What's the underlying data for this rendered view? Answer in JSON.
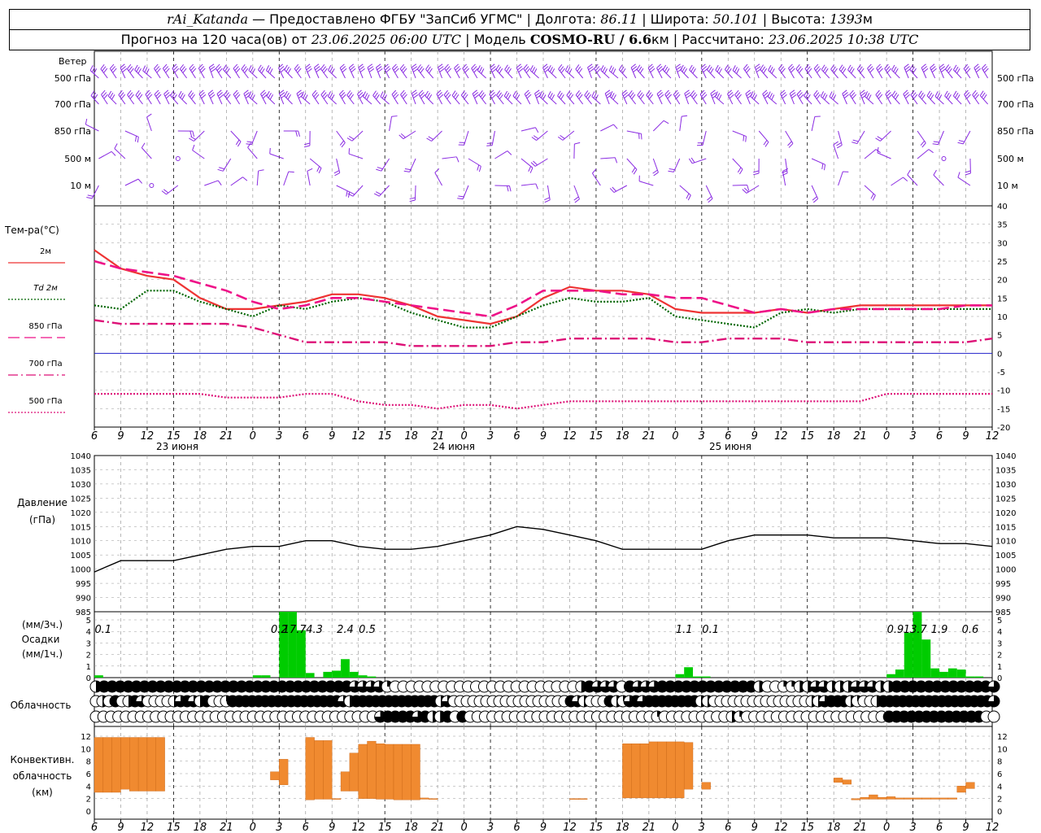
{
  "header": {
    "station": "rAi_Katanda",
    "dash": "—",
    "provided": "Предоставлено ФГБУ \"ЗапСиб УГМС\"",
    "lon_label": "Долгота:",
    "lon": "86.11",
    "lat_label": "Широта:",
    "lat": "50.101",
    "alt_label": "Высота:",
    "alt": "1393",
    "alt_unit": "м",
    "forecast_prefix": "Прогноз на 120 часа(ов) от",
    "forecast_date": "23.06.2025 06:00 UTC",
    "model_label": "Модель",
    "model": "COSMO-RU / 6.6",
    "model_unit": "км",
    "calc_label": "Рассчитано:",
    "calc_date": "23.06.2025 10:38 UTC"
  },
  "colors": {
    "wind": "#8a2be2",
    "t2m": "#ee3333",
    "td2m": "#006600",
    "t850": "#ee1188",
    "t700": "#dd1177",
    "t500": "#dd1177",
    "zero_line": "#2222cc",
    "pressure": "#000000",
    "precip": "#00cc00",
    "conv": "#f08a30",
    "grid": "#999999"
  },
  "chart_data": [
    {
      "type": "wind_barbs",
      "panel_label": "Ветер",
      "levels": [
        "500 гПа",
        "700 гПа",
        "850 гПа",
        "500 м",
        "10 м"
      ]
    },
    {
      "type": "line",
      "panel_label": "Тем-ра(°C)",
      "ylim": [
        -20,
        40
      ],
      "yticks": [
        -20,
        -15,
        -10,
        -5,
        0,
        5,
        10,
        15,
        20,
        25,
        30,
        35,
        40
      ],
      "x_hours": [
        0,
        3,
        6,
        9,
        12,
        15,
        18,
        21,
        24,
        27,
        30,
        33,
        36,
        39,
        42,
        45,
        48,
        51,
        54,
        57,
        60,
        63,
        66,
        69,
        72,
        75,
        78,
        81,
        84,
        87,
        90,
        93,
        96,
        99,
        102
      ],
      "x_tick_labels": [
        "6",
        "9",
        "12",
        "15",
        "18",
        "21",
        "0",
        "3",
        "6",
        "9",
        "12",
        "15",
        "18",
        "21",
        "0",
        "3",
        "6",
        "9",
        "12",
        "15",
        "18",
        "21",
        "0",
        "3",
        "6",
        "9",
        "12",
        "15",
        "18",
        "21",
        "0",
        "3",
        "6",
        "9",
        "12"
      ],
      "day_labels": [
        "23 июня",
        "24 июня",
        "25 июня"
      ],
      "series": [
        {
          "name": "2м",
          "style": "solid",
          "values": [
            28,
            23,
            21,
            20,
            15,
            12,
            12,
            13,
            14,
            16,
            16,
            15,
            13,
            10,
            9,
            8,
            10,
            15,
            18,
            17,
            17,
            16,
            12,
            11,
            11,
            11,
            12,
            11,
            12,
            13,
            13,
            13,
            13,
            13,
            13
          ]
        },
        {
          "name": "Td 2м",
          "style": "dotted",
          "values": [
            13,
            12,
            17,
            17,
            14,
            12,
            10,
            13,
            12,
            14,
            15,
            14,
            11,
            9,
            7,
            7,
            10,
            13,
            15,
            14,
            14,
            15,
            10,
            9,
            8,
            7,
            11,
            12,
            11,
            12,
            12,
            12,
            12,
            12,
            12
          ]
        },
        {
          "name": "850 гПа",
          "style": "longdash",
          "values": [
            25,
            23,
            22,
            21,
            19,
            17,
            14,
            12,
            13,
            15,
            15,
            14,
            13,
            12,
            11,
            10,
            13,
            17,
            17,
            17,
            16,
            16,
            15,
            15,
            13,
            11,
            12,
            11,
            12,
            12,
            12,
            12,
            12,
            13,
            13
          ]
        },
        {
          "name": "700 гПа",
          "style": "dashdot",
          "values": [
            9,
            8,
            8,
            8,
            8,
            8,
            7,
            5,
            3,
            3,
            3,
            3,
            2,
            2,
            2,
            2,
            3,
            3,
            4,
            4,
            4,
            4,
            3,
            3,
            4,
            4,
            4,
            3,
            3,
            3,
            3,
            3,
            3,
            3,
            4
          ]
        },
        {
          "name": "500 гПа",
          "style": "dotted",
          "values": [
            -11,
            -11,
            -11,
            -11,
            -11,
            -12,
            -12,
            -12,
            -11,
            -11,
            -13,
            -14,
            -14,
            -15,
            -14,
            -14,
            -15,
            -14,
            -13,
            -13,
            -13,
            -13,
            -13,
            -13,
            -13,
            -13,
            -13,
            -13,
            -13,
            -13,
            -11,
            -11,
            -11,
            -11,
            -11
          ]
        }
      ]
    },
    {
      "type": "line",
      "panel_label": "Давление",
      "panel_unit": "(гПа)",
      "ylim": [
        985,
        1040
      ],
      "yticks": [
        985,
        990,
        995,
        1000,
        1005,
        1010,
        1015,
        1020,
        1025,
        1030,
        1035,
        1040
      ],
      "series": [
        {
          "name": "Давление",
          "values": [
            999,
            1003,
            1003,
            1003,
            1005,
            1007,
            1008,
            1008,
            1010,
            1010,
            1008,
            1007,
            1007,
            1008,
            1010,
            1012,
            1015,
            1014,
            1012,
            1010,
            1007,
            1007,
            1007,
            1007,
            1010,
            1012,
            1012,
            1012,
            1011,
            1011,
            1011,
            1010,
            1009,
            1009,
            1008
          ]
        }
      ]
    },
    {
      "type": "bar",
      "panel_label_top": "(мм/3ч.)",
      "panel_label_mid": "Осадки",
      "panel_label_bot": "(мм/1ч.)",
      "ylim": [
        0,
        5
      ],
      "yticks": [
        0,
        1,
        2,
        3,
        4,
        5
      ],
      "labels_3h": [
        {
          "hour": 2,
          "text": "0.1"
        },
        {
          "hour": 42,
          "text": "0.2"
        },
        {
          "hour": 45.5,
          "text": "17.7"
        },
        {
          "hour": 50,
          "text": "4.3"
        },
        {
          "hour": 57,
          "text": "2.4"
        },
        {
          "hour": 62,
          "text": "0.5"
        },
        {
          "hour": 134,
          "text": "1.1"
        },
        {
          "hour": 140,
          "text": "0.1"
        },
        {
          "hour": 182,
          "text": "0.9"
        },
        {
          "hour": 186.5,
          "text": "13.7"
        },
        {
          "hour": 192,
          "text": "1.9"
        },
        {
          "hour": 199,
          "text": "0.6"
        }
      ],
      "bars": [
        {
          "hour": 0,
          "value": 0.2
        },
        {
          "hour": 36,
          "value": 0.2
        },
        {
          "hour": 38,
          "value": 0.2
        },
        {
          "hour": 42,
          "value": 5.8
        },
        {
          "hour": 44,
          "value": 5.8
        },
        {
          "hour": 46,
          "value": 4.1
        },
        {
          "hour": 48,
          "value": 0.4
        },
        {
          "hour": 52,
          "value": 0.5
        },
        {
          "hour": 54,
          "value": 0.6
        },
        {
          "hour": 56,
          "value": 1.6
        },
        {
          "hour": 58,
          "value": 0.5
        },
        {
          "hour": 60,
          "value": 0.2
        },
        {
          "hour": 62,
          "value": 0.1
        },
        {
          "hour": 132,
          "value": 0.3
        },
        {
          "hour": 134,
          "value": 0.9
        },
        {
          "hour": 136,
          "value": 0.1
        },
        {
          "hour": 138,
          "value": 0.1
        },
        {
          "hour": 180,
          "value": 0.3
        },
        {
          "hour": 182,
          "value": 0.7
        },
        {
          "hour": 184,
          "value": 3.9
        },
        {
          "hour": 186,
          "value": 6.0
        },
        {
          "hour": 188,
          "value": 3.3
        },
        {
          "hour": 190,
          "value": 0.8
        },
        {
          "hour": 192,
          "value": 0.5
        },
        {
          "hour": 194,
          "value": 0.8
        },
        {
          "hour": 196,
          "value": 0.7
        },
        {
          "hour": 198,
          "value": 0.1
        },
        {
          "hour": 200,
          "value": 0.1
        }
      ]
    },
    {
      "type": "cloud_symbols",
      "panel_label": "Облачность",
      "rows": [
        "2444444444444444444444444444444433331000000000000000000000002433304333444444444444200112233222333224444444444443",
        "0204024300002343240014444444444444444432444444444444423000000000000000000432000421343444444442200000000000000022344421002444444444444444443",
        "0000000000000000000000000000000000000034444342240400000000000000000000000001000000000210000000000000000000444444444444400"
      ]
    },
    {
      "type": "bar",
      "panel_label": "Конвективн. облачность (км)",
      "ylim": [
        0,
        13
      ],
      "yticks": [
        0,
        2,
        4,
        6,
        8,
        10,
        12
      ],
      "bars": [
        {
          "hour": 0,
          "base": 3.0,
          "top": 11.8
        },
        {
          "hour": 2,
          "base": 3.0,
          "top": 11.8
        },
        {
          "hour": 4,
          "base": 3.0,
          "top": 11.8
        },
        {
          "hour": 6,
          "base": 3.5,
          "top": 11.8
        },
        {
          "hour": 8,
          "base": 3.2,
          "top": 11.8
        },
        {
          "hour": 10,
          "base": 3.2,
          "top": 11.8
        },
        {
          "hour": 12,
          "base": 3.2,
          "top": 11.8
        },
        {
          "hour": 14,
          "base": 3.2,
          "top": 11.8
        },
        {
          "hour": 40,
          "base": 5.0,
          "top": 6.3
        },
        {
          "hour": 42,
          "base": 4.2,
          "top": 8.3
        },
        {
          "hour": 48,
          "base": 1.8,
          "top": 11.8
        },
        {
          "hour": 50,
          "base": 1.9,
          "top": 11.3
        },
        {
          "hour": 52,
          "base": 1.9,
          "top": 11.3
        },
        {
          "hour": 54,
          "base": 1.9,
          "top": 2.0
        },
        {
          "hour": 56,
          "base": 3.2,
          "top": 6.3
        },
        {
          "hour": 58,
          "base": 3.2,
          "top": 9.3
        },
        {
          "hour": 60,
          "base": 2.0,
          "top": 10.7
        },
        {
          "hour": 62,
          "base": 2.0,
          "top": 11.2
        },
        {
          "hour": 64,
          "base": 1.9,
          "top": 10.8
        },
        {
          "hour": 66,
          "base": 1.9,
          "top": 10.7
        },
        {
          "hour": 68,
          "base": 1.8,
          "top": 10.7
        },
        {
          "hour": 70,
          "base": 1.8,
          "top": 10.7
        },
        {
          "hour": 72,
          "base": 1.8,
          "top": 10.7
        },
        {
          "hour": 74,
          "base": 1.9,
          "top": 2.1
        },
        {
          "hour": 76,
          "base": 1.9,
          "top": 2.0
        },
        {
          "hour": 108,
          "base": 1.9,
          "top": 2.0
        },
        {
          "hour": 110,
          "base": 1.9,
          "top": 2.0
        },
        {
          "hour": 120,
          "base": 2.1,
          "top": 10.8
        },
        {
          "hour": 122,
          "base": 2.1,
          "top": 10.8
        },
        {
          "hour": 124,
          "base": 2.1,
          "top": 10.8
        },
        {
          "hour": 126,
          "base": 2.1,
          "top": 11.1
        },
        {
          "hour": 128,
          "base": 2.1,
          "top": 11.1
        },
        {
          "hour": 130,
          "base": 2.1,
          "top": 11.1
        },
        {
          "hour": 132,
          "base": 2.1,
          "top": 11.1
        },
        {
          "hour": 134,
          "base": 3.5,
          "top": 11.0
        },
        {
          "hour": 138,
          "base": 3.5,
          "top": 4.6
        },
        {
          "hour": 168,
          "base": 4.6,
          "top": 5.3
        },
        {
          "hour": 170,
          "base": 4.3,
          "top": 5.0
        },
        {
          "hour": 172,
          "base": 1.8,
          "top": 2.0
        },
        {
          "hour": 174,
          "base": 1.9,
          "top": 2.2
        },
        {
          "hour": 176,
          "base": 1.9,
          "top": 2.6
        },
        {
          "hour": 178,
          "base": 1.9,
          "top": 2.2
        },
        {
          "hour": 180,
          "base": 1.9,
          "top": 2.3
        },
        {
          "hour": 182,
          "base": 1.9,
          "top": 2.1
        },
        {
          "hour": 184,
          "base": 1.9,
          "top": 2.1
        },
        {
          "hour": 186,
          "base": 1.9,
          "top": 2.1
        },
        {
          "hour": 188,
          "base": 1.9,
          "top": 2.1
        },
        {
          "hour": 190,
          "base": 1.9,
          "top": 2.1
        },
        {
          "hour": 192,
          "base": 1.9,
          "top": 2.1
        },
        {
          "hour": 194,
          "base": 1.9,
          "top": 2.1
        },
        {
          "hour": 196,
          "base": 3.0,
          "top": 4.0
        },
        {
          "hour": 198,
          "base": 3.6,
          "top": 4.6
        }
      ]
    }
  ]
}
